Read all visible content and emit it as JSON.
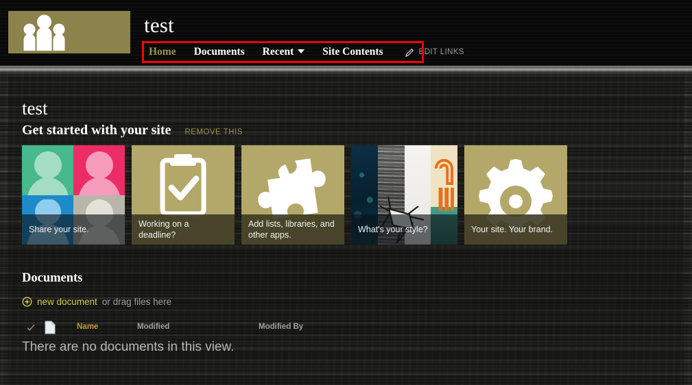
{
  "header": {
    "site_title": "test",
    "logo": {
      "icon": "people-group-icon",
      "bg_color": "#8c824b"
    },
    "nav": [
      {
        "label": "Home",
        "active": true
      },
      {
        "label": "Documents",
        "active": false
      },
      {
        "label": "Recent",
        "active": false,
        "has_dropdown": true
      },
      {
        "label": "Site Contents",
        "active": false
      }
    ],
    "edit_links": {
      "label": "EDIT LINKS",
      "icon": "pencil-icon"
    },
    "highlight_color": "#ff0000"
  },
  "page": {
    "title": "test",
    "get_started": {
      "heading": "Get started with your site",
      "remove_label": "REMOVE THIS"
    },
    "tiles": [
      {
        "caption": "Share your site.",
        "art": "people-mosaic",
        "style": "photo"
      },
      {
        "caption": "Working on a deadline?",
        "art": "clipboard-check-icon",
        "style": "olive"
      },
      {
        "caption": "Add lists, libraries, and other apps.",
        "art": "puzzle-piece-icon",
        "style": "olive"
      },
      {
        "caption": "What's your style?",
        "art": "style-strips",
        "style": "photo"
      },
      {
        "caption": "Your site. Your brand.",
        "art": "gear-icon",
        "style": "olive"
      }
    ]
  },
  "documents": {
    "heading": "Documents",
    "new_document_link": "new document",
    "drag_hint": "or drag files here",
    "new_document_icon": "circle-plus-icon",
    "columns": [
      {
        "label": "Name",
        "accent": true
      },
      {
        "label": "Modified",
        "accent": false
      },
      {
        "label": "Modified By",
        "accent": false
      }
    ],
    "empty_message": "There are no documents in this view.",
    "row_icons": {
      "select_all": "checkmark-icon",
      "doc_type": "document-icon"
    }
  },
  "theme": {
    "accent": "#9b914f",
    "tile_olive": "#b3a869",
    "link_yellow": "#d6cc4e",
    "column_accent": "#c79a3a"
  }
}
